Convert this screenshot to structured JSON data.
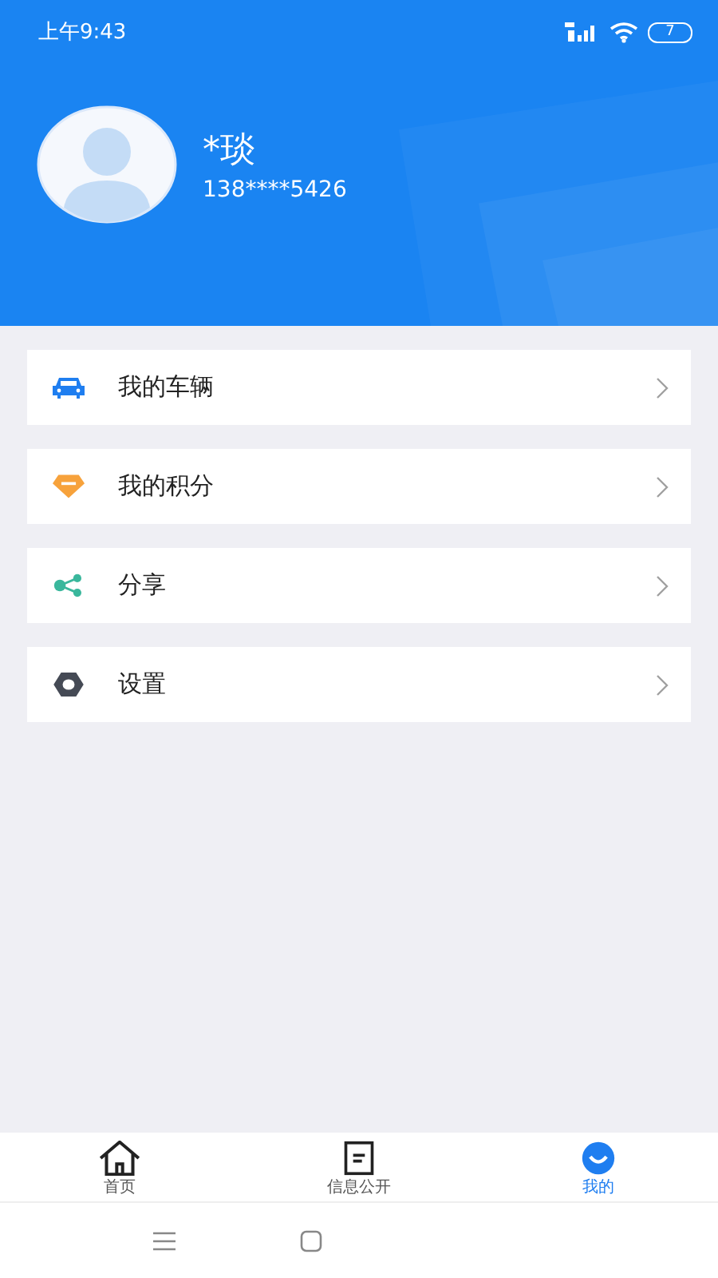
{
  "status_bar": {
    "time": "上午9:43",
    "battery": "7"
  },
  "profile": {
    "name": "*琰",
    "phone": "138****5426"
  },
  "menu": [
    {
      "kind": "car",
      "label": "我的车辆"
    },
    {
      "kind": "points",
      "label": "我的积分"
    },
    {
      "kind": "share",
      "label": "分享"
    },
    {
      "kind": "settings",
      "label": "设置"
    }
  ],
  "tabs": [
    {
      "kind": "home",
      "label": "首页",
      "selected": false
    },
    {
      "kind": "info",
      "label": "信息公开",
      "selected": false
    },
    {
      "kind": "mine",
      "label": "我的",
      "selected": true
    }
  ]
}
